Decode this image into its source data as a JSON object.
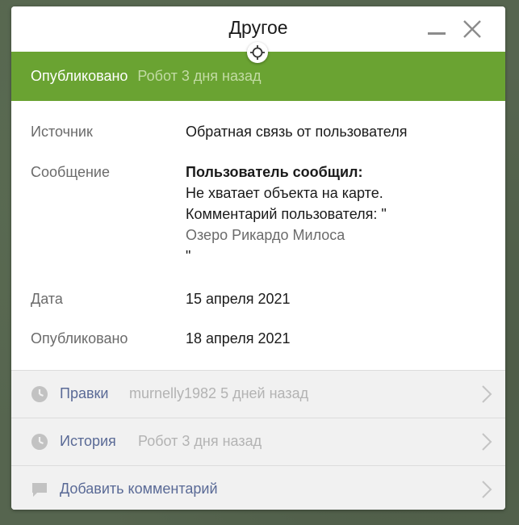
{
  "window": {
    "title": "Другое"
  },
  "status": {
    "label": "Опубликовано",
    "meta": "Робот 3 дня назад",
    "color": "#6aa332"
  },
  "details": {
    "source": {
      "label": "Источник",
      "value": "Обратная связь от пользователя"
    },
    "message": {
      "label": "Сообщение",
      "heading": "Пользователь сообщил:",
      "line1": "Не хватает объекта на карте.",
      "line2": "Комментарий пользователя: \"",
      "line3": "Озеро Рикардо Милоса",
      "line4": "\""
    },
    "date": {
      "label": "Дата",
      "value": "15 апреля 2021"
    },
    "published": {
      "label": "Опубликовано",
      "value": "18 апреля 2021"
    }
  },
  "actions": [
    {
      "label": "Правки",
      "meta": "murnelly1982 5 дней назад",
      "icon": "clock-icon"
    },
    {
      "label": "История",
      "meta": "Робот 3 дня назад",
      "icon": "clock-icon"
    },
    {
      "label": "Добавить комментарий",
      "meta": "",
      "icon": "comment-icon"
    }
  ],
  "colors": {
    "accent": "#6aa332",
    "link": "#5a6a96",
    "muted": "#b3b3b3"
  }
}
